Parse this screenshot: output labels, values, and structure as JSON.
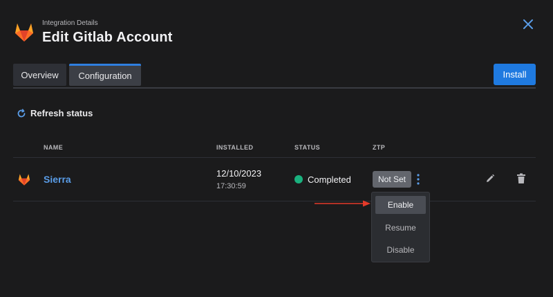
{
  "header": {
    "subtitle": "Integration Details",
    "title": "Edit Gitlab Account",
    "logo_icon": "gitlab-logo",
    "close_icon": "close-icon"
  },
  "tabs": [
    {
      "label": "Overview",
      "active": false
    },
    {
      "label": "Configuration",
      "active": true
    }
  ],
  "actions": {
    "install_label": "Install",
    "refresh_label": "Refresh status"
  },
  "table": {
    "columns": [
      "NAME",
      "INSTALLED",
      "STATUS",
      "ZTP"
    ],
    "rows": [
      {
        "name": "Sierra",
        "installed_date": "12/10/2023",
        "installed_time": "17:30:59",
        "status": "Completed",
        "ztp": "Not Set"
      }
    ]
  },
  "ztp_menu": {
    "items": [
      "Enable",
      "Resume",
      "Disable"
    ],
    "highlighted": "Enable"
  },
  "colors": {
    "background": "#1b1b1c",
    "accent": "#1f7ae0",
    "link": "#5a9de8",
    "status_completed": "#1ab17e",
    "gitlab_orange": "#e24329",
    "annotation_arrow": "#e53a2a"
  }
}
